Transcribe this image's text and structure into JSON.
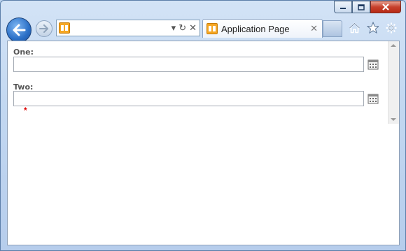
{
  "browser": {
    "tab": {
      "title": "Application Page",
      "close_glyph": "✕"
    },
    "address": {
      "value": "",
      "dropdown_glyph": "▾",
      "refresh_glyph": "↻",
      "stop_glyph": "✕"
    },
    "icons": {
      "back": "back-arrow-icon",
      "forward": "forward-arrow-icon",
      "home": "home-icon",
      "favorites": "star-icon",
      "tools": "gear-icon",
      "site": "site-favicon-icon"
    }
  },
  "form": {
    "fields": [
      {
        "label": "One:",
        "value": "",
        "icon": "calendar-icon"
      },
      {
        "label": "Two:",
        "value": "",
        "icon": "calendar-icon",
        "required_marker": "*"
      }
    ]
  },
  "colors": {
    "frame": "#c3d8f1",
    "back_button": "#2a6fc6",
    "close_button": "#c7412d",
    "favicon": "#f5a623",
    "required": "#dd0000"
  }
}
